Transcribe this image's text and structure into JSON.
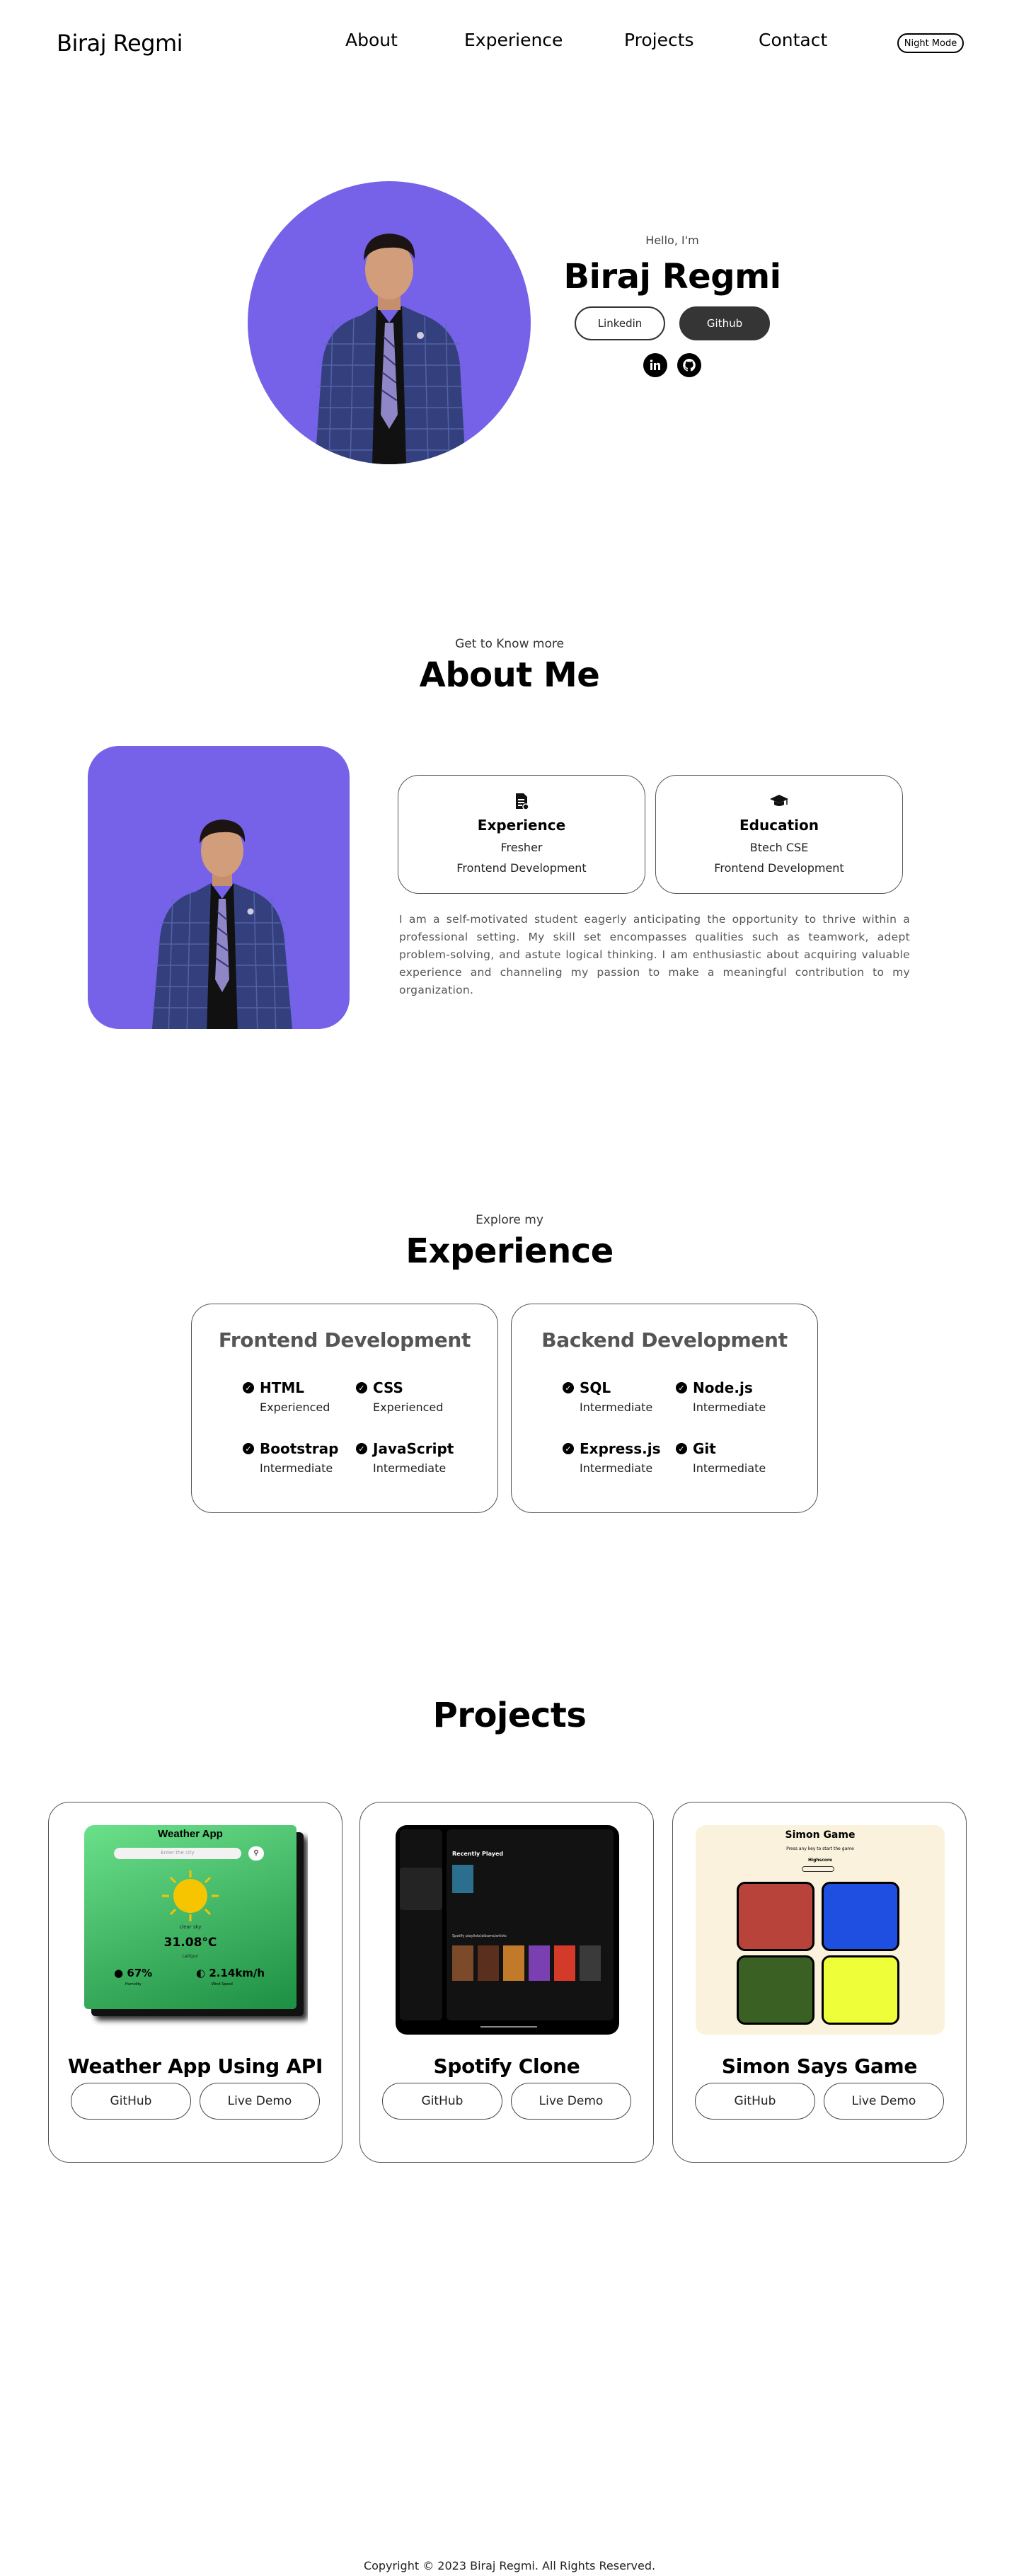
{
  "nav": {
    "logo": "Biraj Regmi",
    "links": [
      "About",
      "Experience",
      "Projects",
      "Contact"
    ],
    "night_mode": "Night Mode"
  },
  "hero": {
    "greeting": "Hello, I'm",
    "name": "Biraj Regmi",
    "linkedin_btn": "Linkedin",
    "github_btn": "Github"
  },
  "about": {
    "subtitle": "Get to Know more",
    "title": "About Me",
    "cards": [
      {
        "title": "Experience",
        "line1": "Fresher",
        "line2": "Frontend Development",
        "icon": "experience-icon"
      },
      {
        "title": "Education",
        "line1": "Btech CSE",
        "line2": "Frontend Development",
        "icon": "education-icon"
      }
    ],
    "paragraph": "I am a self-motivated student eagerly anticipating the opportunity to thrive within a professional setting. My skill set encompasses qualities such as teamwork, adept problem-solving, and astute logical thinking. I am enthusiastic about acquiring valuable experience and channeling my passion to make a meaningful contribution to my organization."
  },
  "experience": {
    "subtitle": "Explore my",
    "title": "Experience",
    "cards": [
      {
        "title": "Frontend Development",
        "skills": [
          {
            "name": "HTML",
            "level": "Experienced"
          },
          {
            "name": "CSS",
            "level": "Experienced"
          },
          {
            "name": "Bootstrap",
            "level": "Intermediate"
          },
          {
            "name": "JavaScript",
            "level": "Intermediate"
          }
        ]
      },
      {
        "title": "Backend Development",
        "skills": [
          {
            "name": "SQL",
            "level": "Intermediate"
          },
          {
            "name": "Node.js",
            "level": "Intermediate"
          },
          {
            "name": "Express.js",
            "level": "Intermediate"
          },
          {
            "name": "Git",
            "level": "Intermediate"
          }
        ]
      }
    ]
  },
  "projects": {
    "title": "Projects",
    "items": [
      {
        "title": "Weather App Using API",
        "github": "GitHub",
        "demo": "Live Demo",
        "screenshot": {
          "app_title": "Weather App",
          "search_placeholder": "Enter the city",
          "condition": "clear sky",
          "temp": "31.08°C",
          "location": "Lalitpur",
          "humidity": "67%",
          "humidity_label": "Humidity",
          "wind": "2.14km/h",
          "wind_label": "Wind Speed"
        }
      },
      {
        "title": "Spotify Clone",
        "github": "GitHub",
        "demo": "Live Demo",
        "screenshot": {
          "heading": "Recently Played",
          "subheading": "Spotify playlists/albums/artists"
        }
      },
      {
        "title": "Simon Says Game",
        "github": "GitHub",
        "demo": "Live Demo",
        "screenshot": {
          "game_title": "Simon Game",
          "instruction": "Press any key to start the game",
          "highscore": "Highscore",
          "colors": [
            "#b8433a",
            "#1f4fe0",
            "#3a6123",
            "#eeff3a"
          ]
        }
      }
    ]
  },
  "footer": {
    "text": "Copyright © 2023 Biraj Regmi. All Rights Reserved."
  },
  "colors": {
    "accent_purple": "#7562e8",
    "dark_button": "#353535"
  }
}
